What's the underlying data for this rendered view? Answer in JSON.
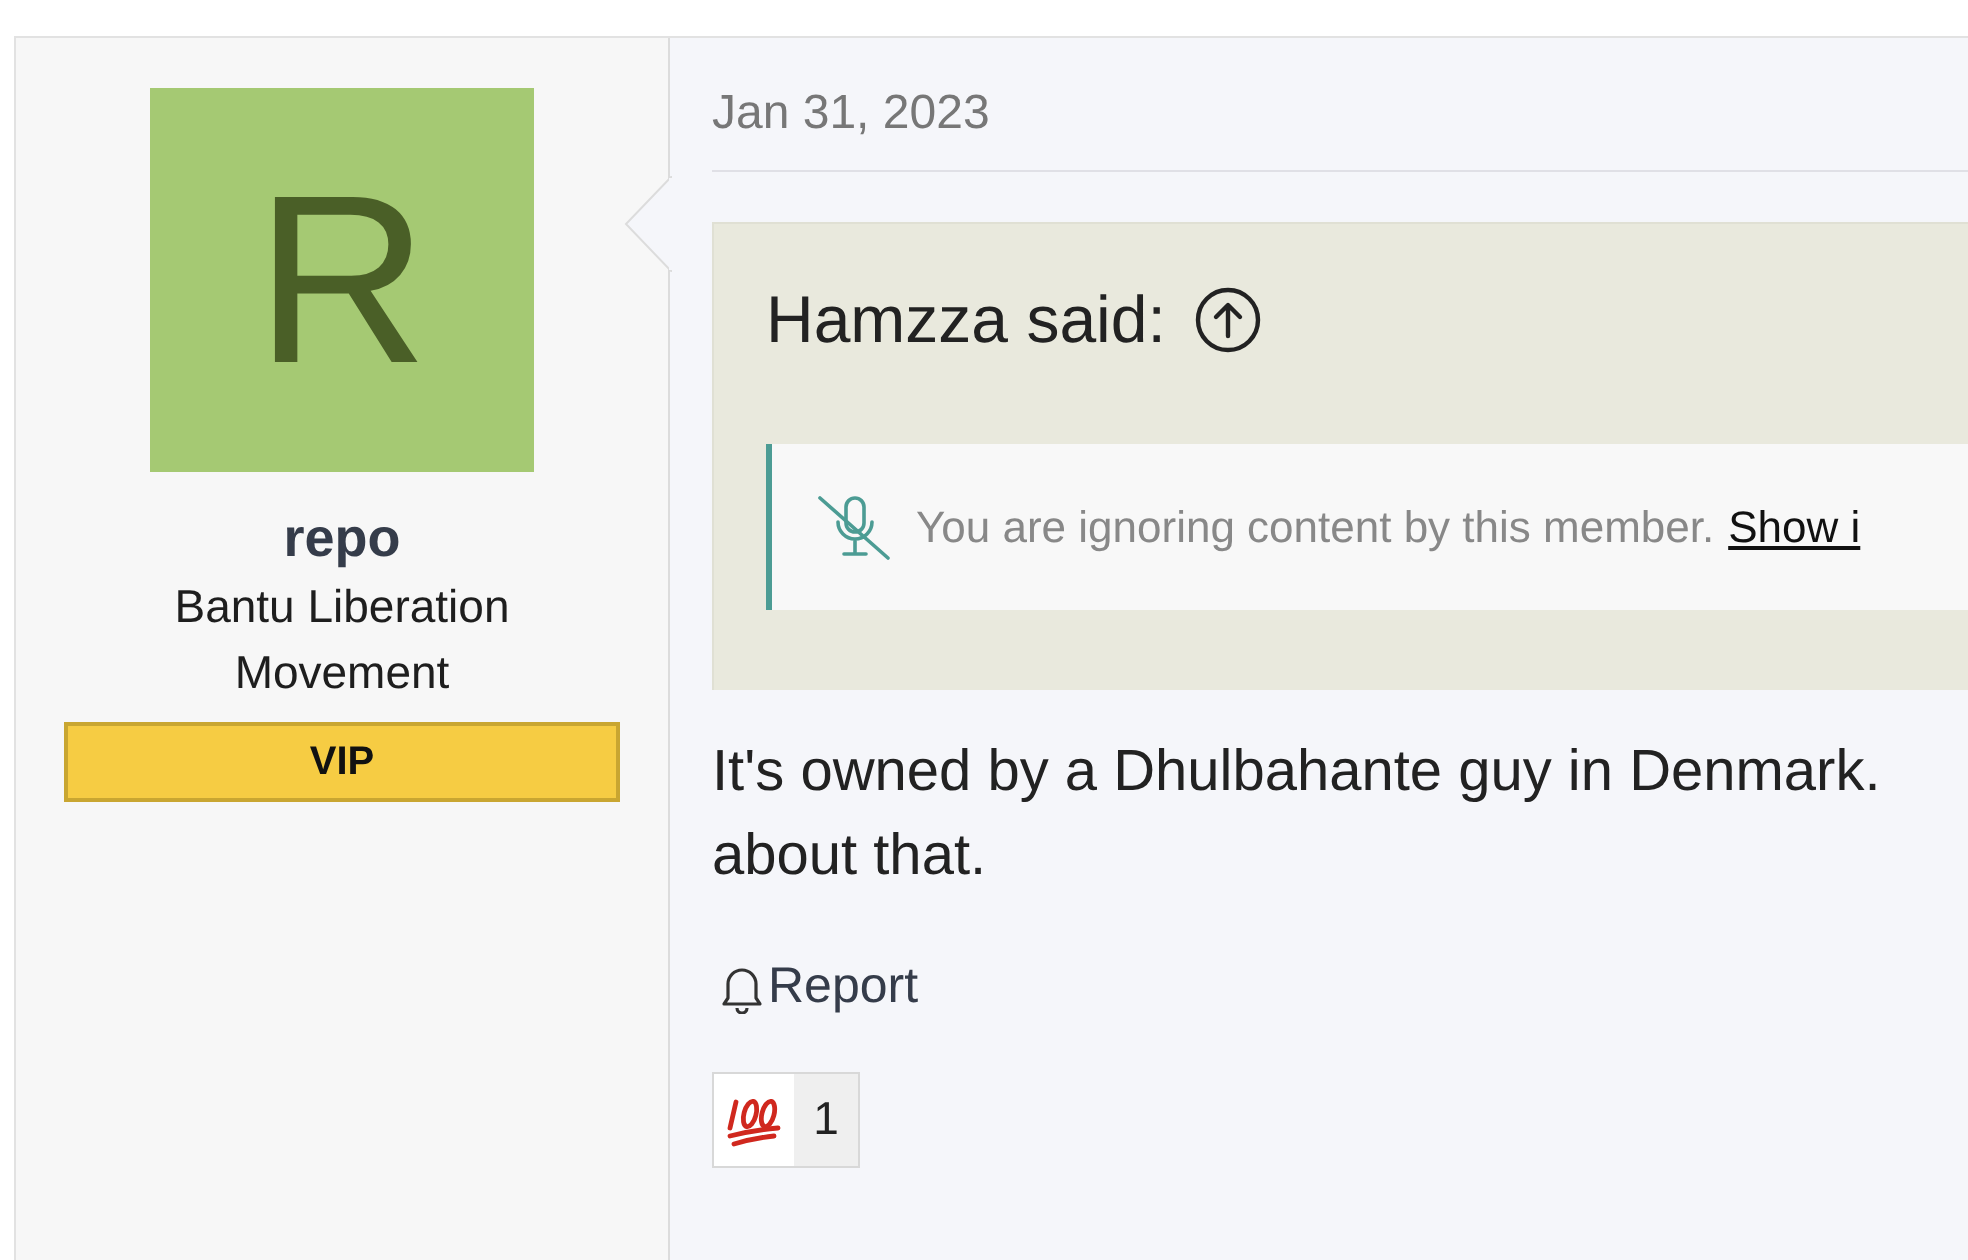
{
  "author": {
    "avatar_letter": "R",
    "name": "repo",
    "title": "Bantu Liberation Movement",
    "badge": "VIP"
  },
  "post": {
    "date": "Jan 31, 2023",
    "quote": {
      "author_line": "Hamzza said:",
      "ignored_notice": "You are ignoring content by this member.",
      "show_link": "Show i"
    },
    "body_lines": [
      "It's owned by a Dhulbahante guy in Denmark.",
      "about that."
    ],
    "report_label": "Report",
    "reactions": [
      {
        "count": "1"
      }
    ]
  }
}
